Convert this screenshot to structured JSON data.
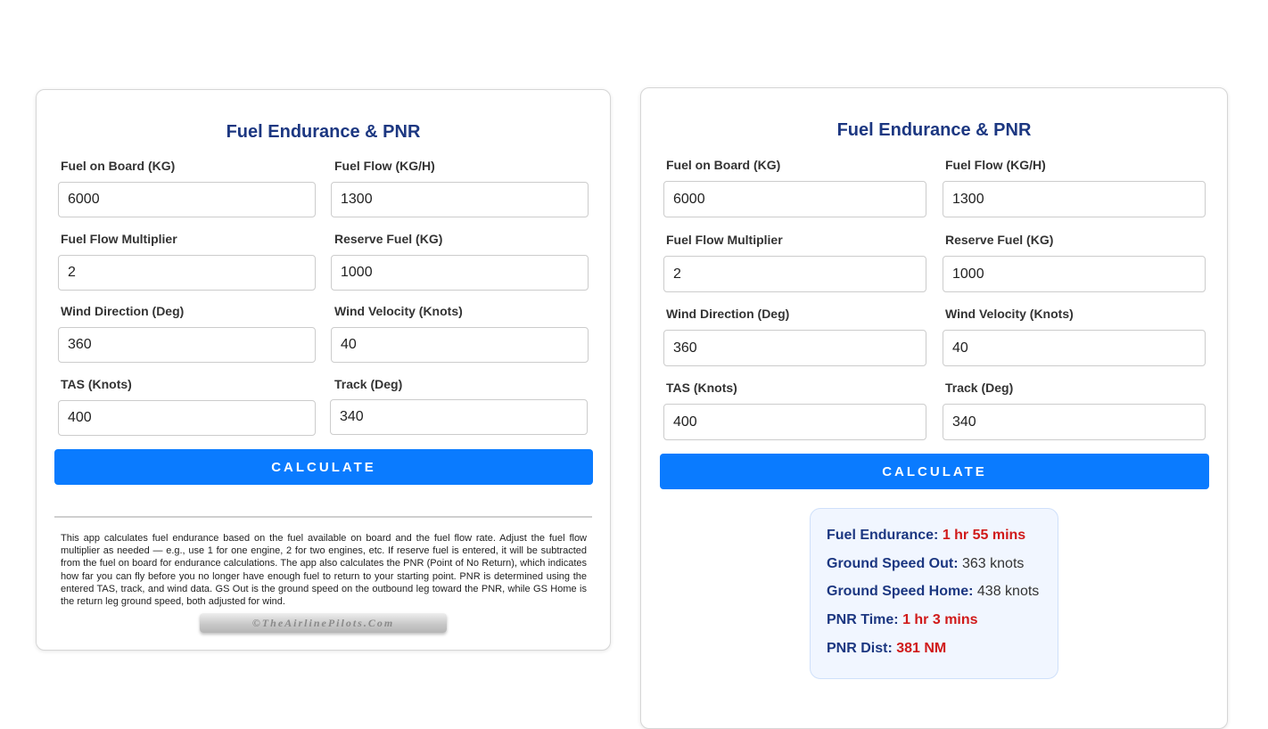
{
  "colors": {
    "title": "#1c3781",
    "button": "#0a7bff",
    "highlight": "#d01a1a",
    "results_bg": "#f1f6ff"
  },
  "left_panel": {
    "title": "Fuel Endurance & PNR",
    "fields": [
      {
        "label": "Fuel on Board (KG)",
        "value": "6000"
      },
      {
        "label": "Fuel Flow (KG/H)",
        "value": "1300"
      },
      {
        "label": "Fuel Flow Multiplier",
        "value": "2"
      },
      {
        "label": "Reserve Fuel (KG)",
        "value": "1000"
      },
      {
        "label": "Wind Direction (Deg)",
        "value": "360"
      },
      {
        "label": "Wind Velocity (Knots)",
        "value": "40"
      },
      {
        "label": "TAS (Knots)",
        "value": "400"
      },
      {
        "label": "Track (Deg)",
        "value": "340"
      }
    ],
    "calculate_label": "CALCULATE",
    "description": "This app calculates fuel endurance based on the fuel available on board and the fuel flow rate. Adjust the fuel flow multiplier as needed — e.g., use 1 for one engine, 2 for two engines, etc. If reserve fuel is entered, it will be subtracted from the fuel on board for endurance calculations. The app also calculates the PNR (Point of No Return), which indicates how far you can fly before you no longer have enough fuel to return to your starting point. PNR is determined using the entered TAS, track, and wind data. GS Out is the ground speed on the outbound leg toward the PNR, while GS Home is the return leg ground speed, both adjusted for wind.",
    "watermark": "©TheAirlinePilots.Com"
  },
  "right_panel": {
    "title": "Fuel Endurance & PNR",
    "fields": [
      {
        "label": "Fuel on Board (KG)",
        "value": "6000"
      },
      {
        "label": "Fuel Flow (KG/H)",
        "value": "1300"
      },
      {
        "label": "Fuel Flow Multiplier",
        "value": "2"
      },
      {
        "label": "Reserve Fuel (KG)",
        "value": "1000"
      },
      {
        "label": "Wind Direction (Deg)",
        "value": "360"
      },
      {
        "label": "Wind Velocity (Knots)",
        "value": "40"
      },
      {
        "label": "TAS (Knots)",
        "value": "400"
      },
      {
        "label": "Track (Deg)",
        "value": "340"
      }
    ],
    "calculate_label": "CALCULATE",
    "results": {
      "endurance": {
        "label": "Fuel Endurance:",
        "value": "1 hr 55 mins"
      },
      "gs_out": {
        "label": "Ground Speed Out:",
        "value": "363 knots"
      },
      "gs_home": {
        "label": "Ground Speed Home:",
        "value": "438 knots"
      },
      "pnr_time": {
        "label": "PNR Time:",
        "value": "1 hr 3 mins"
      },
      "pnr_dist": {
        "label": "PNR Dist:",
        "value": "381 NM"
      }
    }
  }
}
